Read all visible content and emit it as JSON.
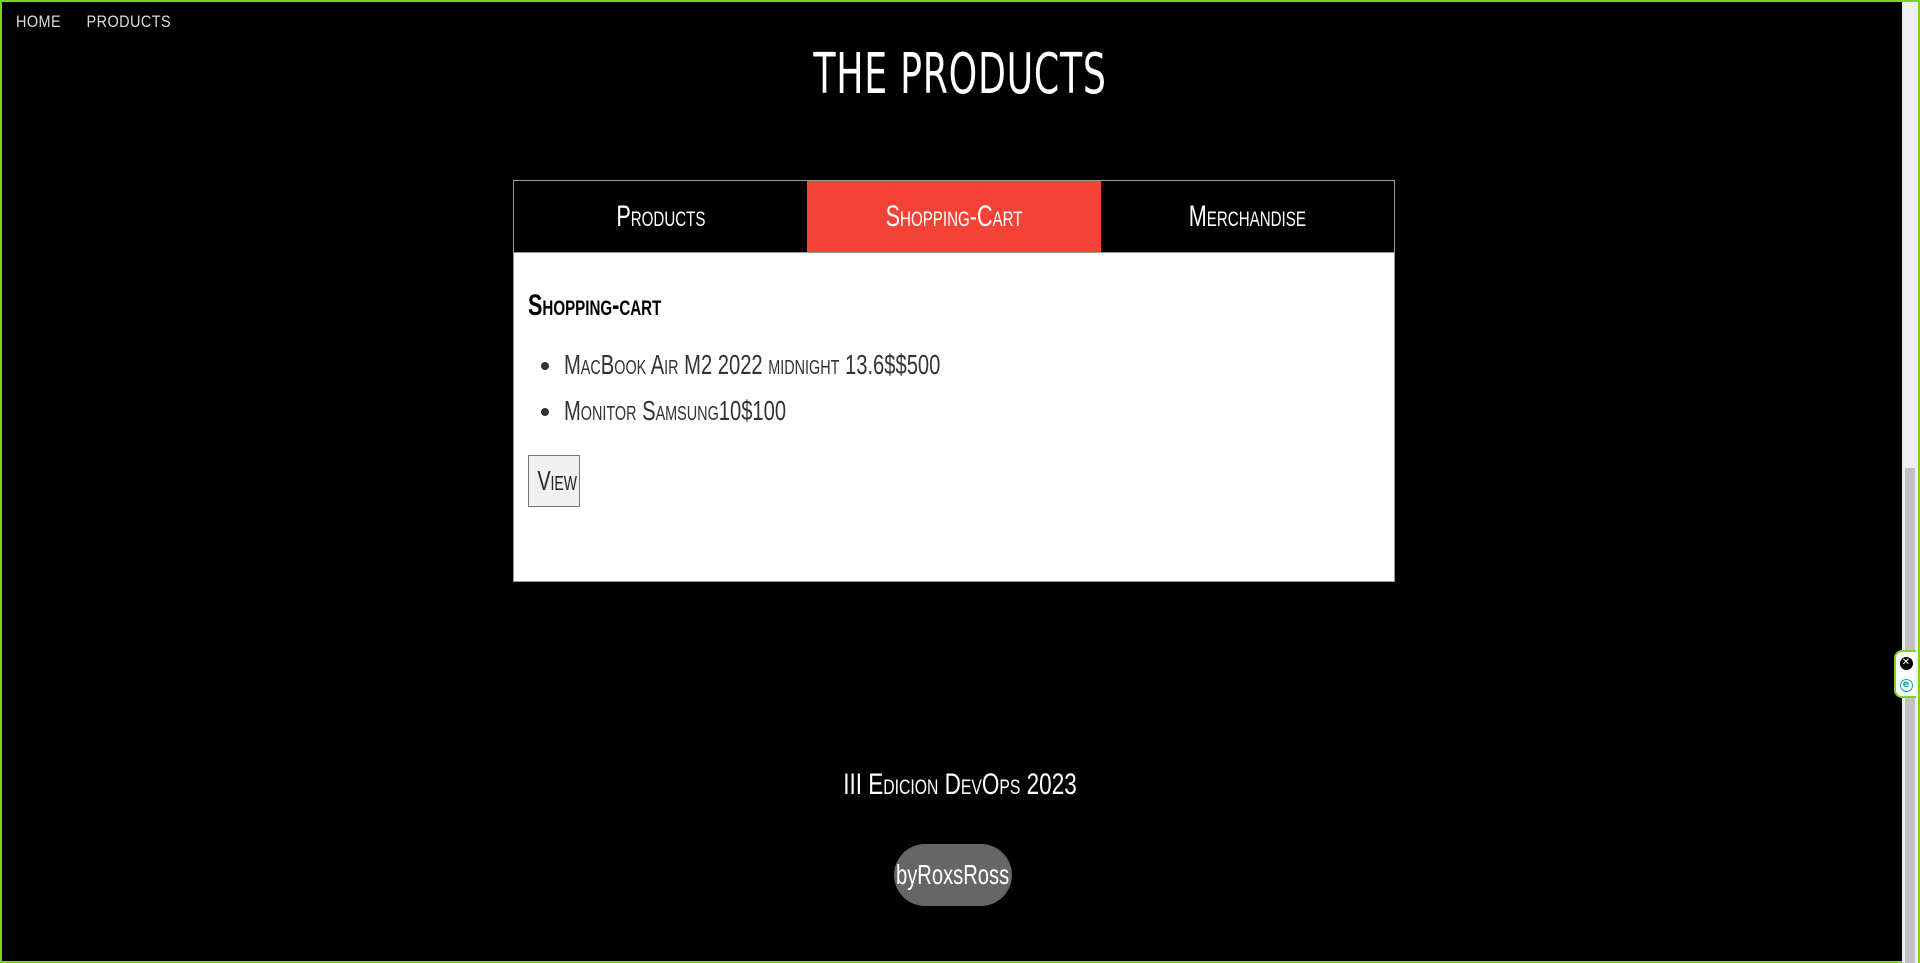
{
  "nav": {
    "items": [
      "HOME",
      "PRODUCTS"
    ]
  },
  "page": {
    "title": "THE PRODUCTS"
  },
  "tabs": [
    {
      "label": "Products",
      "active": false
    },
    {
      "label": "Shopping-Cart",
      "active": true
    },
    {
      "label": "Merchandise",
      "active": false
    }
  ],
  "cart": {
    "title": "Shopping-cart",
    "items": [
      "MacBook Air M2 2022 midnight 13.6$$500",
      "Monitor Samsung10$100"
    ],
    "view_label": "View"
  },
  "footer": {
    "text": "III Edicion DevOps 2023",
    "author": "byRoxsRoss"
  },
  "colors": {
    "background": "#000000",
    "active_tab": "#f44336",
    "author_pill": "#666666",
    "frame_border": "#7ed321"
  },
  "widget": {
    "icons": [
      "close-icon",
      "e-extension-icon"
    ]
  }
}
